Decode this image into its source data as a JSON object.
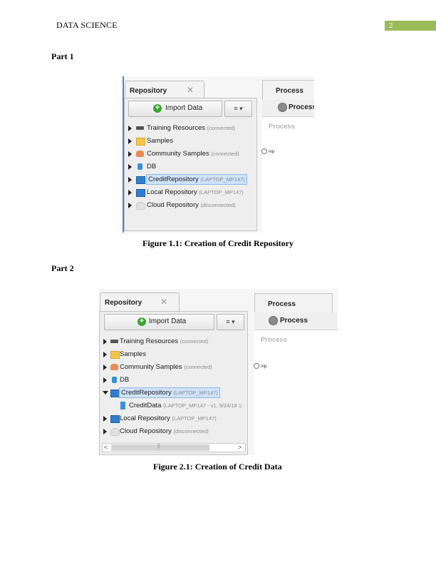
{
  "header": {
    "title": "DATA SCIENCE",
    "page_number": "2"
  },
  "part1": {
    "heading": "Part 1",
    "caption": "Figure 1.1: Creation of Credit Repository",
    "screenshot": {
      "tab_label": "Repository",
      "import_button": "Import Data",
      "menu_button": "≡ ▾",
      "tree": [
        {
          "label": "Training Resources",
          "status": "(connected)",
          "icon": "graduation-cap-icon"
        },
        {
          "label": "Samples",
          "status": "",
          "icon": "folder-icon"
        },
        {
          "label": "Community Samples",
          "status": "(connected)",
          "icon": "people-icon"
        },
        {
          "label": "DB",
          "status": "",
          "icon": "database-icon"
        },
        {
          "label": "CreditRepository",
          "status": "(LAPTOP_MP147)",
          "icon": "monitor-icon",
          "selected": true
        },
        {
          "label": "Local Repository",
          "status": "(LAPTOP_MP147)",
          "icon": "monitor-icon"
        },
        {
          "label": "Cloud Repository",
          "status": "(disconnected)",
          "icon": "cloud-icon"
        }
      ],
      "process_tab": "Process",
      "process_bar_label": "Process",
      "canvas_label": "Process",
      "port_label": "inp"
    }
  },
  "part2": {
    "heading": "Part 2",
    "caption": "Figure 2.1: Creation of Credit Data",
    "screenshot": {
      "tab_label": "Repository",
      "import_button": "Import Data",
      "menu_button": "≡ ▾",
      "tree": [
        {
          "label": "Training Resources",
          "status": "(connected)",
          "icon": "graduation-cap-icon"
        },
        {
          "label": "Samples",
          "status": "",
          "icon": "folder-icon"
        },
        {
          "label": "Community Samples",
          "status": "(connected)",
          "icon": "people-icon"
        },
        {
          "label": "DB",
          "status": "",
          "icon": "database-icon"
        },
        {
          "label": "CreditRepository",
          "status": "(LAPTOP_MP147)",
          "icon": "monitor-icon",
          "selected": true,
          "expanded": true
        },
        {
          "label": "CreditData",
          "status": "(LAPTOP_MP147 - v1, 9/24/18 1:",
          "icon": "data-file-icon",
          "child": true
        },
        {
          "label": "Local Repository",
          "status": "(LAPTOP_MP147)",
          "icon": "monitor-icon"
        },
        {
          "label": "Cloud Repository",
          "status": "(disconnected)",
          "icon": "cloud-icon"
        }
      ],
      "process_tab": "Process",
      "process_bar_label": "Process",
      "canvas_label": "Process",
      "port_label": "inp",
      "scrollbar": {
        "left_arrow": "<",
        "right_arrow": ">",
        "grip": "||"
      }
    }
  }
}
